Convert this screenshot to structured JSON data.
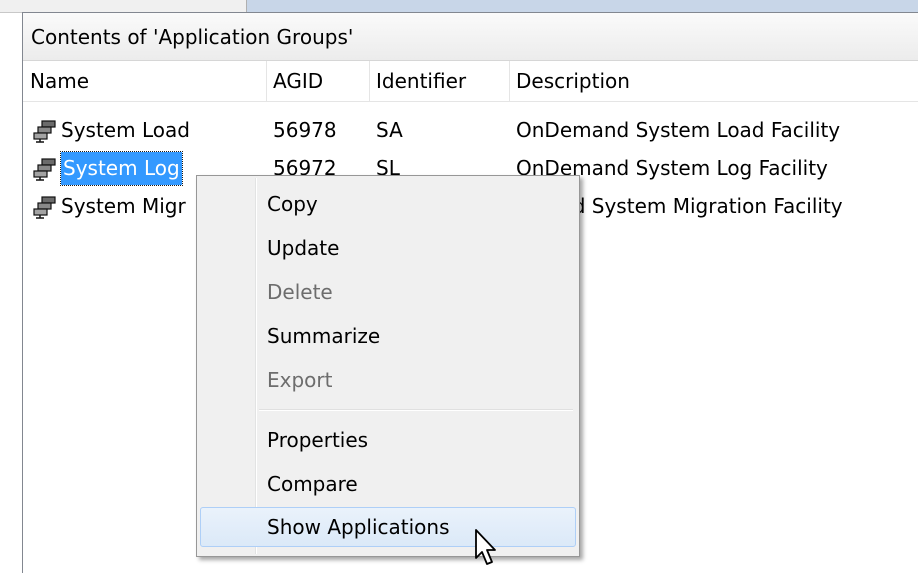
{
  "pane": {
    "title": "Contents of 'Application Groups'"
  },
  "columns": {
    "name": "Name",
    "agid": "AGID",
    "identifier": "Identifier",
    "description": "Description"
  },
  "rows": [
    {
      "name": "System Load",
      "agid": "56978",
      "identifier": "SA",
      "description": "OnDemand System Load Facility"
    },
    {
      "name": "System Log",
      "agid": "56972",
      "identifier": "SL",
      "description": "OnDemand System Log Facility",
      "selected": true
    },
    {
      "name": "System Migr",
      "agid": "",
      "identifier": "",
      "description": "emand System Migration Facility"
    }
  ],
  "context_menu": {
    "items": [
      {
        "label": "Copy",
        "enabled": true
      },
      {
        "label": "Update",
        "enabled": true
      },
      {
        "label": "Delete",
        "enabled": false
      },
      {
        "label": "Summarize",
        "enabled": true
      },
      {
        "label": "Export",
        "enabled": false
      },
      {
        "label": "Properties",
        "enabled": true
      },
      {
        "label": "Compare",
        "enabled": true
      },
      {
        "label": "Show Applications",
        "enabled": true,
        "hovered": true
      }
    ]
  },
  "icons": {
    "row_icon": "application-group-icon",
    "cursor": "mouse-pointer-icon"
  },
  "colors": {
    "selection": "#3399ff",
    "menu_hover_border": "#aecff7",
    "disabled_text": "#6d6d6d"
  }
}
